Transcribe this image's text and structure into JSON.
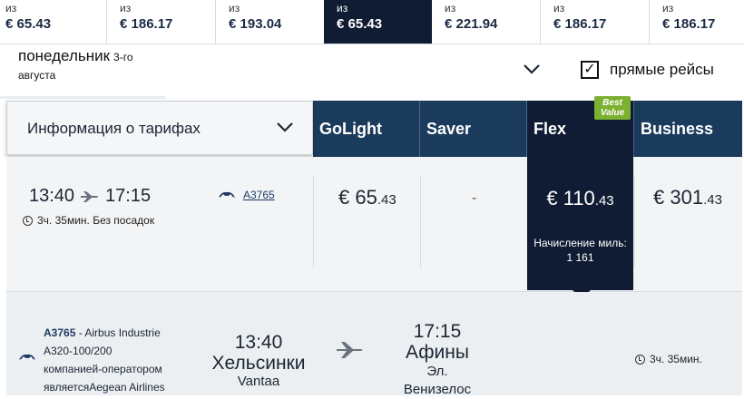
{
  "date_strip": [
    {
      "from": "из",
      "price": "€ 65.43",
      "selected": false
    },
    {
      "from": "из",
      "price": "€ 186.17",
      "selected": false
    },
    {
      "from": "из",
      "price": "€ 193.04",
      "selected": false
    },
    {
      "from": "из",
      "price": "€ 65.43",
      "selected": true
    },
    {
      "from": "из",
      "price": "€ 221.94",
      "selected": false
    },
    {
      "from": "из",
      "price": "€ 186.17",
      "selected": false
    },
    {
      "from": "из",
      "price": "€ 186.17",
      "selected": false
    }
  ],
  "day": {
    "name": "понедельник",
    "num": "3-го",
    "month": "августа"
  },
  "direct_flights": {
    "label": "прямые рейсы",
    "checked": true,
    "mark": "✓"
  },
  "fare_info_label": "Информация о тарифах",
  "fare_columns": [
    "GoLight",
    "Saver",
    "Flex",
    "Business"
  ],
  "best_value": {
    "line1": "Best",
    "line2": "Value",
    "color": "#7bb031"
  },
  "flight": {
    "dep_time": "13:40",
    "arr_time": "17:15",
    "duration": "3ч. 35мин. Без посадок",
    "flight_no": "A3765",
    "prices": {
      "golight": {
        "main": "€ 65",
        "cents": ".43"
      },
      "saver": "-",
      "flex": {
        "main": "€ 110",
        "cents": ".43"
      },
      "business": {
        "main": "€ 301",
        "cents": ".43"
      }
    },
    "miles_label": "Начисление миль:",
    "miles_value": "1 161"
  },
  "segment": {
    "flight_no": "A3765",
    "line1_rest": " - Airbus Industrie",
    "line2": "A320-100/200",
    "line3": "компанией-оператором",
    "line4": "являетсяAegean Airlines",
    "dep_time": "13:40",
    "dep_city": "Хельсинки",
    "dep_airport": "Vantaa",
    "arr_time": "17:15",
    "arr_city": "Афины",
    "arr_airport_l1": "Эл.",
    "arr_airport_l2": "Венизелос",
    "duration": "3ч. 35мин."
  },
  "colors": {
    "navy": "#0f1c33",
    "header_blue": "#1b3b5c",
    "best_value": "#7bb031"
  }
}
